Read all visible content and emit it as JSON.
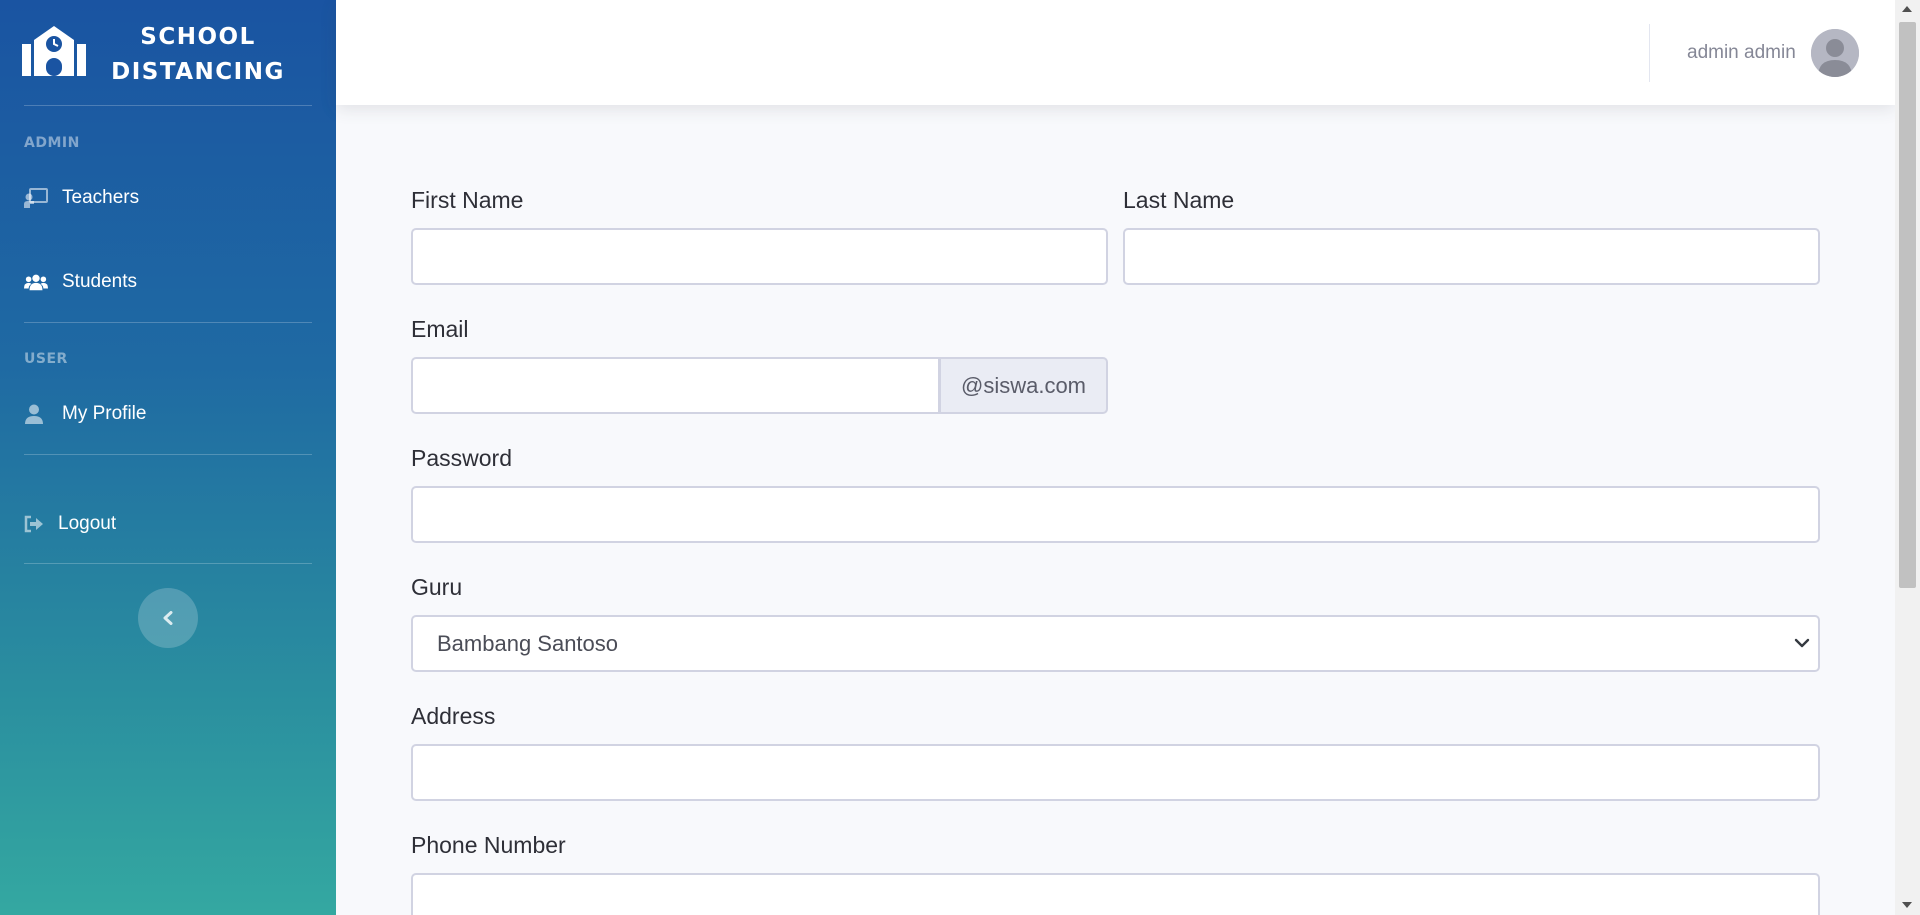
{
  "sidebar": {
    "brand": {
      "line1": "SCHOOL",
      "line2": "DISTANCING"
    },
    "sections": [
      {
        "heading": "ADMIN"
      },
      {
        "heading": "USER"
      }
    ],
    "items": [
      {
        "label": "Teachers",
        "icon": "chalkboard-teacher-icon"
      },
      {
        "label": "Students",
        "icon": "users-icon"
      },
      {
        "label": "My Profile",
        "icon": "user-icon"
      },
      {
        "label": "Logout",
        "icon": "sign-out-icon"
      }
    ],
    "collapse_icon": "chevron-left-icon"
  },
  "topbar": {
    "user_name": "admin admin",
    "avatar_icon": "user-avatar-icon"
  },
  "form": {
    "first_name": {
      "label": "First Name",
      "value": ""
    },
    "last_name": {
      "label": "Last Name",
      "value": ""
    },
    "email": {
      "label": "Email",
      "value": "",
      "suffix": "@siswa.com"
    },
    "password": {
      "label": "Password",
      "value": ""
    },
    "guru": {
      "label": "Guru",
      "selected": "Bambang Santoso"
    },
    "address": {
      "label": "Address",
      "value": ""
    },
    "phone": {
      "label": "Phone Number",
      "value": ""
    }
  },
  "colors": {
    "sidebar_gradient_top": "#1a54a2",
    "sidebar_gradient_bottom": "#34a8a1",
    "page_background": "#f8f9fc"
  }
}
